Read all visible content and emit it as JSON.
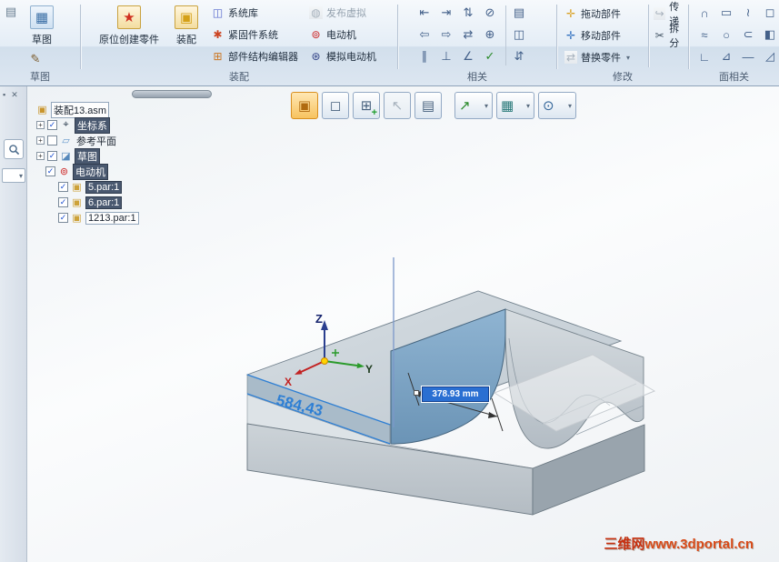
{
  "ui": {
    "caret": "▾",
    "expand": "+",
    "check": "✓",
    "close_glyph": "✕",
    "pin_glyph": "▪"
  },
  "ribbon": {
    "group_labels": [
      "草图",
      "装配",
      "相关",
      "修改",
      "面相关"
    ],
    "sketch_group": {
      "page_icon": "▤",
      "big_label": "草图",
      "big_icon": "▦",
      "pencil_icon": "✎"
    },
    "assembly_group": {
      "create_inplace": {
        "label": "原位创建零件",
        "icon": "★"
      },
      "assemble": {
        "label": "装配",
        "icon": "▣"
      },
      "col1": [
        {
          "icon": "◫",
          "label": "系统库"
        },
        {
          "icon": "✱",
          "label": "紧固件系统"
        },
        {
          "icon": "⊞",
          "label": "部件结构编辑器"
        }
      ],
      "col2": [
        {
          "icon": "◍",
          "label": "发布虚拟"
        },
        {
          "icon": "⊚",
          "label": "电动机"
        },
        {
          "icon": "⊛",
          "label": "模拟电动机"
        }
      ]
    },
    "related_group": {
      "rows": [
        [
          "⇤",
          "⇥",
          "⇅",
          "⊘",
          "▤"
        ],
        [
          "⇦",
          "⇨",
          "⇄",
          "⊕",
          "◫"
        ],
        [
          "∥",
          "⊥",
          "∠",
          "✓",
          "⇵"
        ]
      ]
    },
    "modify_group": {
      "items": [
        {
          "icon": "✛",
          "label": "拖动部件"
        },
        {
          "icon": "✛",
          "label": "移动部件"
        },
        {
          "icon": "⇄",
          "label": "替换零件"
        }
      ],
      "right": [
        {
          "icon": "↪",
          "label": "传递"
        },
        {
          "icon": "✂",
          "label": "拆分"
        }
      ]
    },
    "face_group": {
      "rows": [
        [
          "∩",
          "▭",
          "≀",
          "◻"
        ],
        [
          "≈",
          "○",
          "⊂",
          "◧"
        ],
        [
          "∟",
          "⊿",
          "—",
          "◿"
        ]
      ]
    }
  },
  "tree": {
    "root": "装配13.asm",
    "root_icon": "▣",
    "items": [
      {
        "icon": "⌖",
        "label": "坐标系",
        "checked": true,
        "selected": true
      },
      {
        "icon": "▱",
        "label": "参考平面",
        "checked": false,
        "selected": false
      },
      {
        "icon": "◪",
        "label": "草图",
        "checked": true,
        "selected": true
      },
      {
        "icon": "⊚",
        "label": "电动机",
        "checked": true,
        "selected": true
      },
      {
        "icon": "▣",
        "label": "5.par:1",
        "checked": true,
        "selected": true
      },
      {
        "icon": "▣",
        "label": "6.par:1",
        "checked": true,
        "selected": true
      },
      {
        "icon": "▣",
        "label": "1213.par:1",
        "checked": true,
        "selected": false
      }
    ]
  },
  "viewport_toolbar": {
    "buttons": [
      {
        "name": "show-part",
        "glyph": "▣"
      },
      {
        "name": "hide-part",
        "glyph": "◻"
      },
      {
        "name": "add-part",
        "glyph": "⊞",
        "plus": "+"
      },
      {
        "name": "select-cursor",
        "glyph": "↖"
      },
      {
        "name": "report-list",
        "glyph": "▤"
      },
      {
        "name": "arrow-tool",
        "glyph": "↗"
      },
      {
        "name": "window-grid",
        "glyph": "▦"
      },
      {
        "name": "target-circle",
        "glyph": "⊙"
      }
    ]
  },
  "scene": {
    "dim_width": "584,43",
    "dim_box": "378.93 mm",
    "axes": {
      "x": "X",
      "y": "Y",
      "z": "Z"
    },
    "watermark_prefix": "三维网",
    "watermark_url": "www.3dportal.cn"
  },
  "colors": {
    "accent_orange": "#d98f1f",
    "dim_blue": "#2e7fd4",
    "selection_bg": "#49586f",
    "dimbox_bg": "#2a6fd2",
    "watermark_red": "#c73010"
  }
}
